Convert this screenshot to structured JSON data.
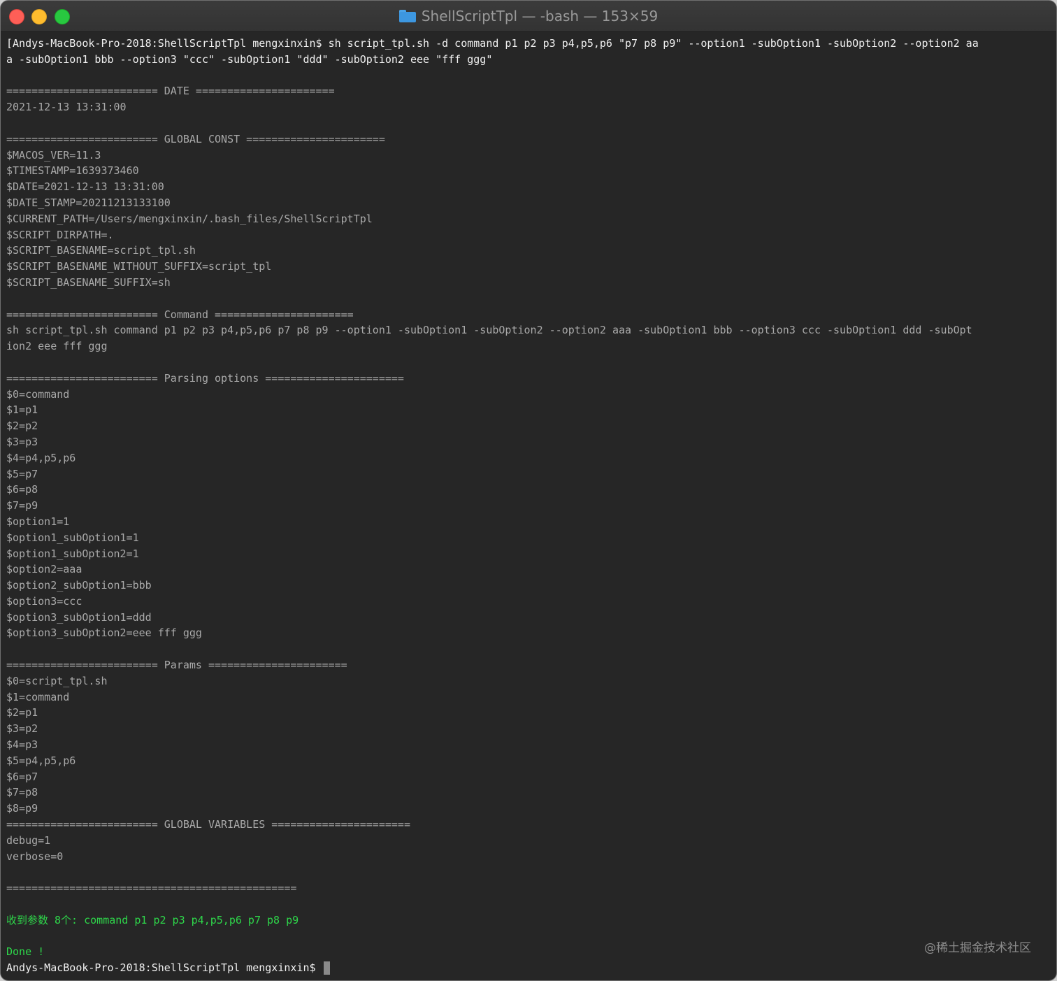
{
  "window": {
    "title": "ShellScriptTpl — -bash — 153×59"
  },
  "terminal": {
    "lines": [
      {
        "text": "[Andys-MacBook-Pro-2018:ShellScriptTpl mengxinxin$ sh script_tpl.sh -d command p1 p2 p3 p4,p5,p6 \"p7 p8 p9\" --option1 -subOption1 -subOption2 --option2 aa",
        "style": "bright"
      },
      {
        "text": "a -subOption1 bbb --option3 \"ccc\" -subOption1 \"ddd\" -subOption2 eee \"fff ggg\"",
        "style": "bright"
      },
      {
        "text": "",
        "style": "dim"
      },
      {
        "text": "======================== DATE ======================",
        "style": "dim"
      },
      {
        "text": "2021-12-13 13:31:00",
        "style": "dim"
      },
      {
        "text": "",
        "style": "dim"
      },
      {
        "text": "======================== GLOBAL CONST ======================",
        "style": "dim"
      },
      {
        "text": "$MACOS_VER=11.3",
        "style": "dim"
      },
      {
        "text": "$TIMESTAMP=1639373460",
        "style": "dim"
      },
      {
        "text": "$DATE=2021-12-13 13:31:00",
        "style": "dim"
      },
      {
        "text": "$DATE_STAMP=20211213133100",
        "style": "dim"
      },
      {
        "text": "$CURRENT_PATH=/Users/mengxinxin/.bash_files/ShellScriptTpl",
        "style": "dim"
      },
      {
        "text": "$SCRIPT_DIRPATH=.",
        "style": "dim"
      },
      {
        "text": "$SCRIPT_BASENAME=script_tpl.sh",
        "style": "dim"
      },
      {
        "text": "$SCRIPT_BASENAME_WITHOUT_SUFFIX=script_tpl",
        "style": "dim"
      },
      {
        "text": "$SCRIPT_BASENAME_SUFFIX=sh",
        "style": "dim"
      },
      {
        "text": "",
        "style": "dim"
      },
      {
        "text": "======================== Command ======================",
        "style": "dim"
      },
      {
        "text": "sh script_tpl.sh command p1 p2 p3 p4,p5,p6 p7 p8 p9 --option1 -subOption1 -subOption2 --option2 aaa -subOption1 bbb --option3 ccc -subOption1 ddd -subOpt",
        "style": "dim"
      },
      {
        "text": "ion2 eee fff ggg",
        "style": "dim"
      },
      {
        "text": "",
        "style": "dim"
      },
      {
        "text": "======================== Parsing options ======================",
        "style": "dim"
      },
      {
        "text": "$0=command",
        "style": "dim"
      },
      {
        "text": "$1=p1",
        "style": "dim"
      },
      {
        "text": "$2=p2",
        "style": "dim"
      },
      {
        "text": "$3=p3",
        "style": "dim"
      },
      {
        "text": "$4=p4,p5,p6",
        "style": "dim"
      },
      {
        "text": "$5=p7",
        "style": "dim"
      },
      {
        "text": "$6=p8",
        "style": "dim"
      },
      {
        "text": "$7=p9",
        "style": "dim"
      },
      {
        "text": "$option1=1",
        "style": "dim"
      },
      {
        "text": "$option1_subOption1=1",
        "style": "dim"
      },
      {
        "text": "$option1_subOption2=1",
        "style": "dim"
      },
      {
        "text": "$option2=aaa",
        "style": "dim"
      },
      {
        "text": "$option2_subOption1=bbb",
        "style": "dim"
      },
      {
        "text": "$option3=ccc",
        "style": "dim"
      },
      {
        "text": "$option3_subOption1=ddd",
        "style": "dim"
      },
      {
        "text": "$option3_subOption2=eee fff ggg",
        "style": "dim"
      },
      {
        "text": "",
        "style": "dim"
      },
      {
        "text": "======================== Params ======================",
        "style": "dim"
      },
      {
        "text": "$0=script_tpl.sh",
        "style": "dim"
      },
      {
        "text": "$1=command",
        "style": "dim"
      },
      {
        "text": "$2=p1",
        "style": "dim"
      },
      {
        "text": "$3=p2",
        "style": "dim"
      },
      {
        "text": "$4=p3",
        "style": "dim"
      },
      {
        "text": "$5=p4,p5,p6",
        "style": "dim"
      },
      {
        "text": "$6=p7",
        "style": "dim"
      },
      {
        "text": "$7=p8",
        "style": "dim"
      },
      {
        "text": "$8=p9",
        "style": "dim"
      },
      {
        "text": "======================== GLOBAL VARIABLES ======================",
        "style": "dim"
      },
      {
        "text": "debug=1",
        "style": "dim"
      },
      {
        "text": "verbose=0",
        "style": "dim"
      },
      {
        "text": "",
        "style": "dim"
      },
      {
        "text": "==============================================",
        "style": "dim"
      },
      {
        "text": "",
        "style": "dim"
      },
      {
        "text": "收到参数 8个: command p1 p2 p3 p4,p5,p6 p7 p8 p9",
        "style": "green"
      },
      {
        "text": "",
        "style": "dim"
      },
      {
        "text": "Done !",
        "style": "green"
      }
    ],
    "prompt": "Andys-MacBook-Pro-2018:ShellScriptTpl mengxinxin$ "
  },
  "watermark": "@稀土掘金技术社区",
  "colors": {
    "terminal_bg": "#262626",
    "output_text": "#a9a9a9",
    "command_text": "#f0f0f0",
    "success_text": "#2ed64a",
    "close": "#fe5f57",
    "minimize": "#febc2e",
    "maximize": "#28c840"
  }
}
